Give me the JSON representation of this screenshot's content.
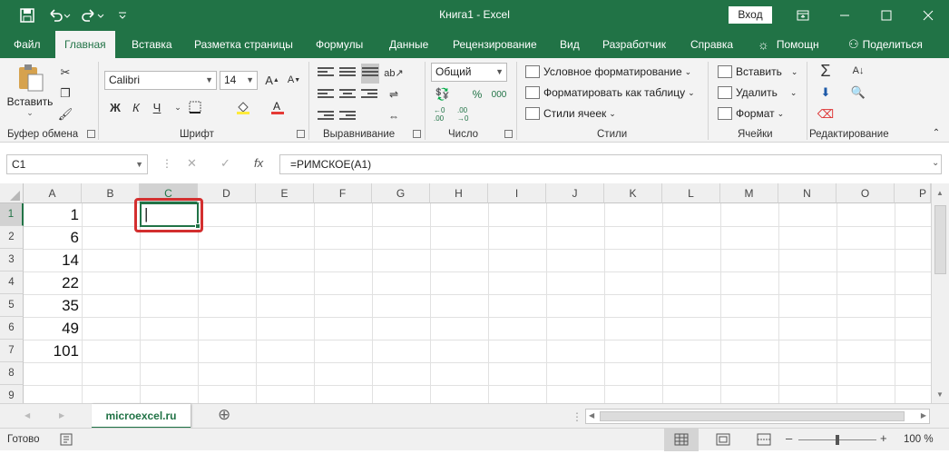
{
  "titlebar": {
    "title": "Книга1 - Excel",
    "signin": "Вход",
    "save_icon": "save-icon",
    "undo_icon": "undo-icon",
    "redo_icon": "redo-icon"
  },
  "tabs": {
    "file": "Файл",
    "home": "Главная",
    "insert": "Вставка",
    "layout": "Разметка страницы",
    "formulas": "Формулы",
    "data": "Данные",
    "review": "Рецензирование",
    "view": "Вид",
    "developer": "Разработчик",
    "help": "Справка",
    "tellme": "Помощн",
    "share": "Поделиться"
  },
  "ribbon": {
    "clipboard": {
      "label": "Буфер обмена",
      "paste": "Вставить"
    },
    "font": {
      "label": "Шрифт",
      "name": "Calibri",
      "size": "14",
      "bold": "Ж",
      "italic": "К",
      "underline": "Ч",
      "grow": "A",
      "shrink": "A"
    },
    "align": {
      "label": "Выравнивание"
    },
    "number": {
      "label": "Число",
      "format": "Общий",
      "percent": "%",
      "comma": "000",
      "inc": "←0 .00",
      "dec": ".00 →0"
    },
    "styles": {
      "label": "Стили",
      "conditional": "Условное форматирование",
      "table": "Форматировать как таблицу",
      "cell": "Стили ячеек"
    },
    "cells": {
      "label": "Ячейки",
      "insert": "Вставить",
      "delete": "Удалить",
      "format": "Формат"
    },
    "editing": {
      "label": "Редактирование",
      "sum": "Σ"
    }
  },
  "formula_bar": {
    "name_box": "C1",
    "fx": "fx",
    "formula": "=РИМСКОЕ(A1)"
  },
  "grid": {
    "columns": [
      "A",
      "B",
      "C",
      "D",
      "E",
      "F",
      "G",
      "H",
      "I",
      "J",
      "K",
      "L",
      "M",
      "N",
      "O",
      "P"
    ],
    "rows": [
      "1",
      "2",
      "3",
      "4",
      "5",
      "6",
      "7",
      "8",
      "9"
    ],
    "colA": [
      "1",
      "6",
      "14",
      "22",
      "35",
      "49",
      "101"
    ],
    "active_cell_text": "|"
  },
  "sheets": {
    "active": "microexcel.ru",
    "add": "⊕"
  },
  "status": {
    "ready": "Готово",
    "zoom": "100 %",
    "minus": "–",
    "plus": "+"
  },
  "colors": {
    "accent": "#217346",
    "highlight_box": "#d32f2f"
  }
}
